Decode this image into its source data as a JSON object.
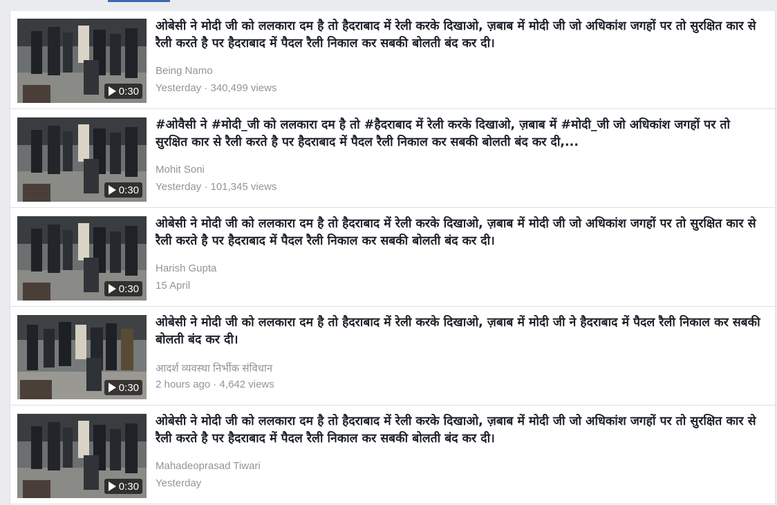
{
  "results": [
    {
      "title": "ओबेसी ने मोदी जी को ललकारा दम है तो हैदराबाद में रेली करके दिखाओ, ज़बाब में मोदी जी जो अधिकांश जगहों पर तो सुरक्षित कार से रैली करते है पर हैदराबाद में पैदल रैली निकाल कर सबकी बोलती बंद कर दी।",
      "author": "Being Namo",
      "meta": "Yesterday · 340,499 views",
      "duration": "0:30"
    },
    {
      "title": "#ओवैसी ने #मोदी_जी को ललकारा दम है तो #हैदराबाद में रेली करके दिखाओ, ज़बाब में #मोदी_जी जो अधिकांश जगहों पर तो सुरक्षित कार से रैली करते है पर हैदराबाद में पैदल रैली निकाल कर सबकी बोलती बंद कर दी,...",
      "author": "Mohit Soni",
      "meta": "Yesterday · 101,345 views",
      "duration": "0:30"
    },
    {
      "title": "ओबेसी ने मोदी जी को ललकारा दम है तो हैदराबाद में रेली करके दिखाओ, ज़बाब में मोदी जी जो अधिकांश जगहों पर तो सुरक्षित कार से रैली करते है पर हैदराबाद में पैदल रैली निकाल कर सबकी बोलती बंद कर दी।",
      "author": "Harish Gupta",
      "meta": "15 April",
      "duration": "0:30"
    },
    {
      "title": "ओबेसी ने मोदी जी को ललकारा दम है तो हैदराबाद में रेली करके दिखाओ, ज़बाब में मोदी जी ने हैदराबाद में पैदल रैली निकाल कर सबकी बोलती बंद कर दी।",
      "author": "आदर्श व्यवस्था निर्भीक संविधान",
      "meta": "2 hours ago · 4,642 views",
      "duration": "0:30"
    },
    {
      "title": "ओबेसी ने मोदी जी को ललकारा दम है तो हैदराबाद में रेली करके दिखाओ, ज़बाब में मोदी जी जो अधिकांश जगहों पर तो सुरक्षित कार से रैली करते है पर हैदराबाद में पैदल रैली निकाल कर सबकी बोलती बंद कर दी।",
      "author": "Mahadeoprasad Tiwari",
      "meta": "Yesterday",
      "duration": "0:30"
    }
  ],
  "colors": {
    "background": "#e9ebee",
    "title": "#1d2129",
    "secondary": "#90949c",
    "accent": "#4267b2"
  },
  "icons": {
    "play": "play-icon"
  }
}
